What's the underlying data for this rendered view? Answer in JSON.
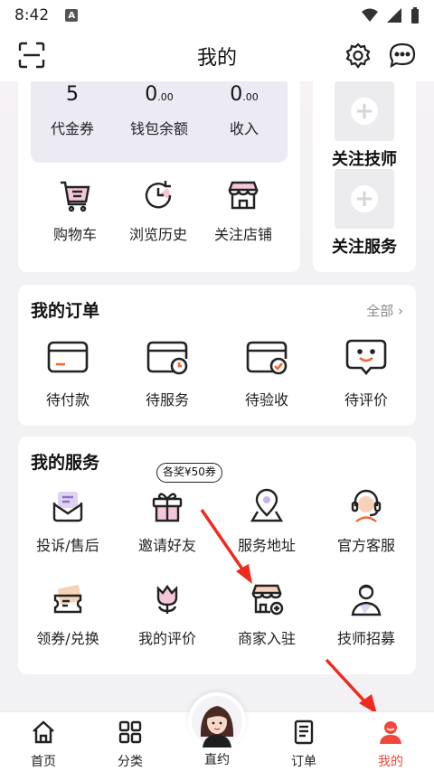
{
  "status": {
    "time": "8:42",
    "badge": "A"
  },
  "header": {
    "title": "我的"
  },
  "wallet": [
    {
      "value": "5",
      "decimal": "",
      "label": "代金券"
    },
    {
      "value": "0",
      "decimal": ".00",
      "label": "钱包余额"
    },
    {
      "value": "0",
      "decimal": ".00",
      "label": "收入"
    }
  ],
  "quick_links": [
    {
      "label": "购物车",
      "icon": "cart-icon"
    },
    {
      "label": "浏览历史",
      "icon": "history-icon"
    },
    {
      "label": "关注店铺",
      "icon": "store-icon"
    }
  ],
  "follow": [
    {
      "label": "关注技师",
      "icon": "plus-icon"
    },
    {
      "label": "关注服务",
      "icon": "plus-icon"
    }
  ],
  "orders": {
    "title": "我的订单",
    "all_label": "全部",
    "items": [
      {
        "label": "待付款",
        "icon": "wallet-card-icon"
      },
      {
        "label": "待服务",
        "icon": "clock-card-icon"
      },
      {
        "label": "待验收",
        "icon": "check-card-icon"
      },
      {
        "label": "待评价",
        "icon": "smile-bubble-icon"
      }
    ]
  },
  "services": {
    "title": "我的服务",
    "bonus_badge": "各奖¥50券",
    "items": [
      {
        "label": "投诉/售后",
        "icon": "mail-icon"
      },
      {
        "label": "邀请好友",
        "icon": "gift-icon"
      },
      {
        "label": "服务地址",
        "icon": "location-pin-icon"
      },
      {
        "label": "官方客服",
        "icon": "headset-icon"
      },
      {
        "label": "领券/兑换",
        "icon": "coupon-icon"
      },
      {
        "label": "我的评价",
        "icon": "tulip-icon"
      },
      {
        "label": "商家入驻",
        "icon": "shop-add-icon"
      },
      {
        "label": "技师招募",
        "icon": "technician-icon"
      }
    ]
  },
  "bottom_nav": [
    {
      "label": "首页",
      "icon": "home-icon"
    },
    {
      "label": "分类",
      "icon": "grid-icon"
    },
    {
      "label": "直约",
      "icon": "avatar-icon"
    },
    {
      "label": "订单",
      "icon": "order-list-icon"
    },
    {
      "label": "我的",
      "icon": "profile-icon",
      "active": true
    }
  ],
  "colors": {
    "accent": "#f0473a",
    "icon_pink": "#f3c6da",
    "icon_orange": "#f06a35"
  }
}
